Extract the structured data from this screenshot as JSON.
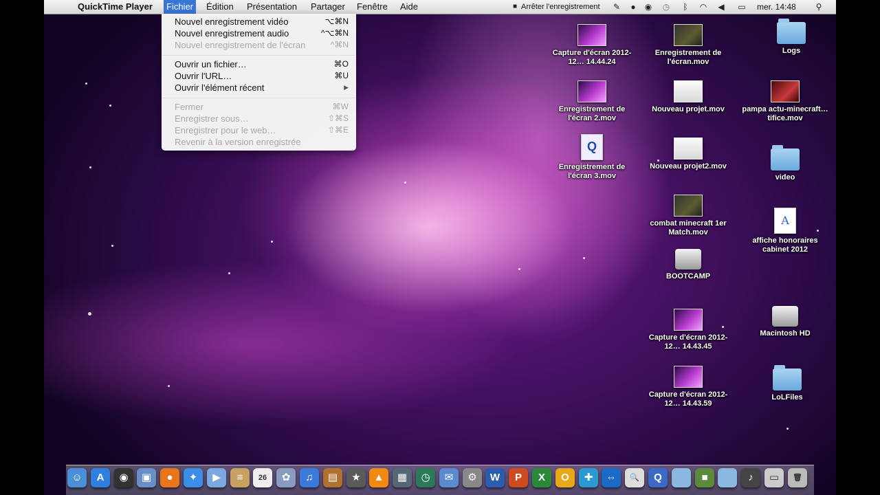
{
  "menubar": {
    "apple": "",
    "app_name": "QuickTime Player",
    "menus": [
      "Fichier",
      "Édition",
      "Présentation",
      "Partager",
      "Fenêtre",
      "Aide"
    ],
    "recording_status": "Arrêter l'enregistrement",
    "clock": "mer. 14:48"
  },
  "file_menu": {
    "items": [
      {
        "label": "Nouvel enregistrement vidéo",
        "shortcut": "⌥⌘N",
        "enabled": true
      },
      {
        "label": "Nouvel enregistrement audio",
        "shortcut": "^⌥⌘N",
        "enabled": true
      },
      {
        "label": "Nouvel enregistrement de l'écran",
        "shortcut": "^⌘N",
        "enabled": false
      },
      {
        "label": "Ouvrir un fichier…",
        "shortcut": "⌘O",
        "enabled": true
      },
      {
        "label": "Ouvrir l'URL…",
        "shortcut": "⌘U",
        "enabled": true
      },
      {
        "label": "Ouvrir l'élément récent",
        "shortcut": "▶",
        "enabled": true
      },
      {
        "label": "Fermer",
        "shortcut": "⌘W",
        "enabled": false
      },
      {
        "label": "Enregistrer sous…",
        "shortcut": "⇧⌘S",
        "enabled": false
      },
      {
        "label": "Enregistrer pour le web…",
        "shortcut": "⇧⌘E",
        "enabled": false
      },
      {
        "label": "Revenir à la version enregistrée",
        "shortcut": "",
        "enabled": false
      }
    ]
  },
  "desktop_icons": [
    {
      "name": "Capture d'écran 2012-12… 14.44.24",
      "kind": "galaxy-thumbnail"
    },
    {
      "name": "Enregistrement de l'écran.mov",
      "kind": "dark-thumbnail"
    },
    {
      "name": "Logs",
      "kind": "folder"
    },
    {
      "name": "Enregistrement de l'écran 2.mov",
      "kind": "galaxy-thumbnail"
    },
    {
      "name": "Nouveau projet.mov",
      "kind": "white-thumbnail"
    },
    {
      "name": "pampa actu-minecraft…tifice.mov",
      "kind": "red-thumbnail"
    },
    {
      "name": "Enregistrement de l'écran 3.mov",
      "kind": "movie-document"
    },
    {
      "name": "Nouveau projet2.mov",
      "kind": "white-thumbnail"
    },
    {
      "name": "video",
      "kind": "folder"
    },
    {
      "name": "combat minecraft 1er Match.mov",
      "kind": "dark-thumbnail"
    },
    {
      "name": "affiche honoraires cabinet 2012",
      "kind": "document"
    },
    {
      "name": "BOOTCAMP",
      "kind": "disk"
    },
    {
      "name": "Capture d'écran 2012-12… 14.43.45",
      "kind": "galaxy-thumbnail"
    },
    {
      "name": "Macintosh HD",
      "kind": "disk"
    },
    {
      "name": "Capture d'écran 2012-12… 14.43.59",
      "kind": "galaxy-thumbnail"
    },
    {
      "name": "LoLFiles",
      "kind": "folder"
    }
  ],
  "dock_items": [
    {
      "name": "finder-icon",
      "color": "#4a8fd8",
      "glyph": "☺"
    },
    {
      "name": "app-store-icon",
      "color": "#2f7fe0",
      "glyph": "A"
    },
    {
      "name": "dashboard-icon",
      "color": "#333333",
      "glyph": "◉"
    },
    {
      "name": "preview-icon",
      "color": "#6a8fc8",
      "glyph": "▣"
    },
    {
      "name": "firefox-icon",
      "color": "#e8751a",
      "glyph": "●"
    },
    {
      "name": "safari-icon",
      "color": "#3a8ee8",
      "glyph": "✦"
    },
    {
      "name": "facetime-icon",
      "color": "#7aa8e0",
      "glyph": "▶"
    },
    {
      "name": "notes-icon",
      "color": "#c8a060",
      "glyph": "≡"
    },
    {
      "name": "calendar-icon",
      "color": "#eeeeee",
      "glyph": "26"
    },
    {
      "name": "iphoto-icon",
      "color": "#8a9ac0",
      "glyph": "✿"
    },
    {
      "name": "itunes-icon",
      "color": "#3a7ad8",
      "glyph": "♫"
    },
    {
      "name": "photo-booth-icon",
      "color": "#b07030",
      "glyph": "▤"
    },
    {
      "name": "imovie-icon",
      "color": "#5a5a5a",
      "glyph": "★"
    },
    {
      "name": "vlc-icon",
      "color": "#f08a10",
      "glyph": "▲"
    },
    {
      "name": "mission-control-icon",
      "color": "#556677",
      "glyph": "▦"
    },
    {
      "name": "time-machine-icon",
      "color": "#2a7a5a",
      "glyph": "◷"
    },
    {
      "name": "mail-icon",
      "color": "#5a8ad0",
      "glyph": "✉"
    },
    {
      "name": "system-preferences-icon",
      "color": "#888888",
      "glyph": "⚙"
    },
    {
      "name": "word-icon",
      "color": "#2a5cb0",
      "glyph": "W"
    },
    {
      "name": "powerpoint-icon",
      "color": "#d04a20",
      "glyph": "P"
    },
    {
      "name": "excel-icon",
      "color": "#2a8a3a",
      "glyph": "X"
    },
    {
      "name": "outlook-icon",
      "color": "#e8a818",
      "glyph": "O"
    },
    {
      "name": "messenger-icon",
      "color": "#2a9ad0",
      "glyph": "✚"
    },
    {
      "name": "teamviewer-icon",
      "color": "#1a6ac8",
      "glyph": "⇔"
    },
    {
      "name": "preview-doc-icon",
      "color": "#dddddd",
      "glyph": "🔍"
    },
    {
      "name": "quicktime-icon",
      "color": "#3a6ac8",
      "glyph": "Q"
    },
    {
      "name": "folder-icon",
      "color": "#8ab8e0",
      "glyph": ""
    },
    {
      "name": "minecraft-icon",
      "color": "#5a8a3a",
      "glyph": "■"
    },
    {
      "name": "documents-folder-icon",
      "color": "#8ab8e0",
      "glyph": ""
    },
    {
      "name": "garageband-icon",
      "color": "#444444",
      "glyph": "♪"
    },
    {
      "name": "downloads-stack-icon",
      "color": "#cccccc",
      "glyph": "▭"
    },
    {
      "name": "trash-icon",
      "color": "#bbbbbb",
      "glyph": "🗑"
    }
  ]
}
